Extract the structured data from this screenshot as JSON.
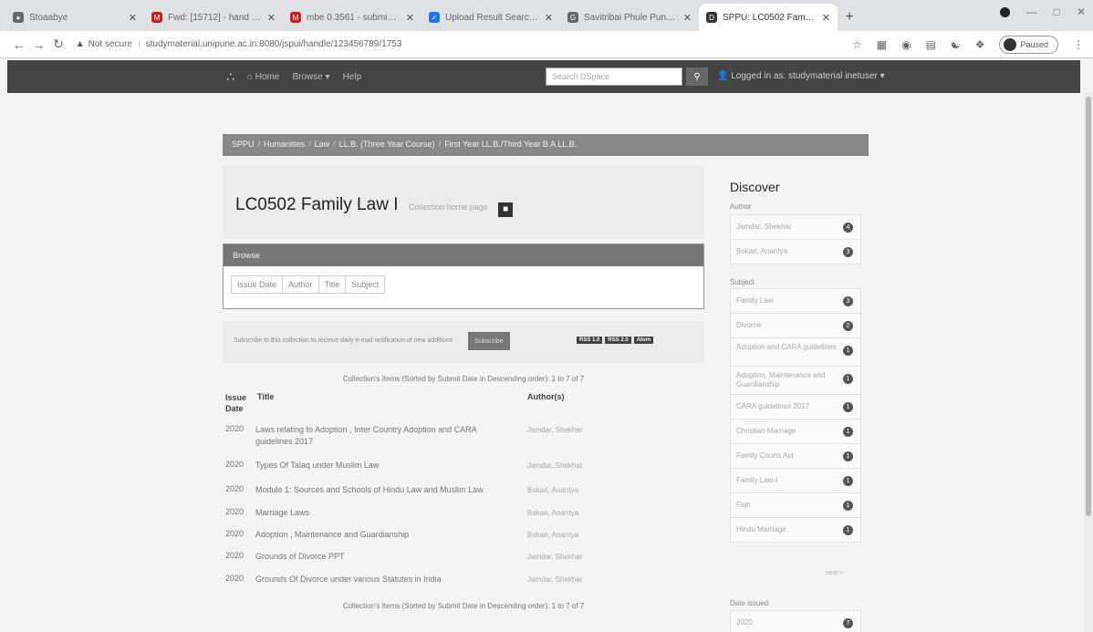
{
  "browser": {
    "tabs": [
      {
        "label": "Stoaabye",
        "fav_color": "#666",
        "fav": "●",
        "active": false
      },
      {
        "label": "Fwd: [15712] - hand subm...",
        "fav_color": "#c5221f",
        "fav": "M",
        "active": false
      },
      {
        "label": "mbe 0.3561 - submissions...",
        "fav_color": "#c5221f",
        "fav": "M",
        "active": false
      },
      {
        "label": "Upload Result Search Results",
        "fav_color": "#1a73e8",
        "fav": "✓",
        "active": false
      },
      {
        "label": "Savitribai Phule Pune Unive...",
        "fav_color": "#666",
        "fav": "G",
        "active": false
      },
      {
        "label": "SPPU: LC0502 Family Law I",
        "fav_color": "#333",
        "fav": "D",
        "active": true
      }
    ],
    "url_warning": "Not secure",
    "url": "studymaterial.unipune.ac.in:8080/jspui/handle/123456789/1753",
    "profile_status": "Paused"
  },
  "site": {
    "logo": "∴",
    "nav": {
      "home": "Home",
      "browse": "Browse ▾",
      "help": "Help"
    },
    "search_placeholder": "Search DSpace",
    "login": "Logged in as: studymaterial inetuser ▾"
  },
  "breadcrumb": [
    "SPPU",
    "Humanities",
    "Law",
    "LL.B. (Three Year Course)",
    "First Year LL.B./Third Year B.A LL.B."
  ],
  "page": {
    "title": "LC0502 Family Law I",
    "homepage_label": "Collection home page"
  },
  "browse": {
    "heading": "Browse",
    "buttons": [
      "Issue Date",
      "Author",
      "Title",
      "Subject"
    ]
  },
  "subscribe": {
    "text": "Subscribe to this collection to receive daily e-mail notification of new additions",
    "button": "Subscribe",
    "feeds": [
      "RSS 1.0",
      "RSS 2.0",
      "Atom"
    ]
  },
  "showing_text": "Collection's Items (Sorted by Submit Date in Descending order): 1 to 7 of 7",
  "table": {
    "headers": {
      "date": "Issue Date",
      "title": "Title",
      "author": "Author(s)"
    },
    "rows": [
      {
        "date": "2020",
        "title": "Laws relating to Adoption , Inter Country Adoption and CARA guidelines 2017",
        "author": "Jamdar, Shekhar"
      },
      {
        "date": "2020",
        "title": "Types Of Talaq under Muslim Law",
        "author": "Jamdar, Shekhar"
      },
      {
        "date": "2020",
        "title": "Module 1: Sources and Schools of Hindu Law and Muslim Law",
        "author": "Bokari, Anantya"
      },
      {
        "date": "2020",
        "title": "Marriage Laws",
        "author": "Bokari, Anantya"
      },
      {
        "date": "2020",
        "title": "Adoption , Maintenance and Guardianship",
        "author": "Bokari, Anantya"
      },
      {
        "date": "2020",
        "title": "Grounds of Divorce PPT",
        "author": "Jamdar, Shekhar"
      },
      {
        "date": "2020",
        "title": "Grounds Of Divorce under various Statutes in India",
        "author": "Jamdar, Shekhar"
      }
    ]
  },
  "sidebar": {
    "heading": "Discover",
    "author_label": "Author",
    "authors": [
      {
        "name": "Jamdar, Shekhar",
        "count": "4"
      },
      {
        "name": "Bokari, Anantya",
        "count": "3"
      }
    ],
    "subject_label": "Subject",
    "subjects": [
      {
        "name": "Family Law",
        "count": "3"
      },
      {
        "name": "Divorce",
        "count": "2"
      },
      {
        "name": "Adoption and CARA guidelines",
        "count": "1"
      },
      {
        "name": "Adoption, Maintenance and Guardianship",
        "count": "1"
      },
      {
        "name": "CARA guidelines 2017",
        "count": "1"
      },
      {
        "name": "Christian Marriage",
        "count": "1"
      },
      {
        "name": "Family Courts Act",
        "count": "1"
      },
      {
        "name": "Family Law-I",
        "count": "1"
      },
      {
        "name": "Fiqh",
        "count": "1"
      },
      {
        "name": "Hindu Marriage",
        "count": "1"
      }
    ],
    "next_label": "next >",
    "date_label": "Date issued",
    "dates": [
      {
        "name": "2020",
        "count": "7"
      }
    ]
  }
}
